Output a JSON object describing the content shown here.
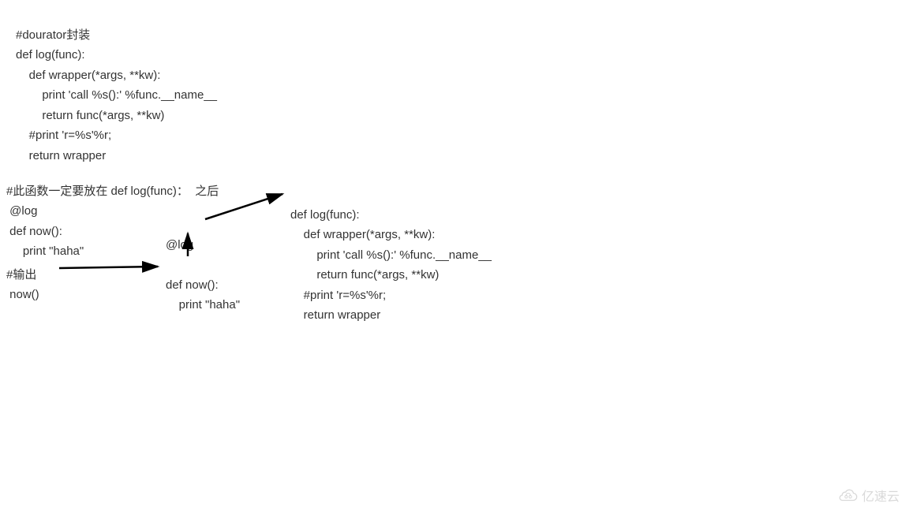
{
  "block1": {
    "l1": "#dourator封装",
    "l2": "def log(func):",
    "l3": "    def wrapper(*args, **kw):",
    "l4": "        print 'call %s():' %func.__name__",
    "l5": "        return func(*args, **kw)",
    "l6": "    #print 'r=%s'%r;",
    "l7": "    return wrapper"
  },
  "block2": {
    "l1": "#此函数一定要放在 def log(func)：  之后",
    "l2": " @log",
    "l3": " def now():",
    "l4": "     print \"haha\""
  },
  "block3": {
    "l1": "#输出",
    "l2": " now()"
  },
  "block4": {
    "l1": "@log",
    "l3": "def now():",
    "l4": "    print \"haha\""
  },
  "block5": {
    "l1": "def log(func):",
    "l2": "    def wrapper(*args, **kw):",
    "l3": "        print 'call %s():' %func.__name__",
    "l4": "        return func(*args, **kw)",
    "l5": "    #print 'r=%s'%r;",
    "l6": "    return wrapper"
  },
  "watermark": "亿速云"
}
